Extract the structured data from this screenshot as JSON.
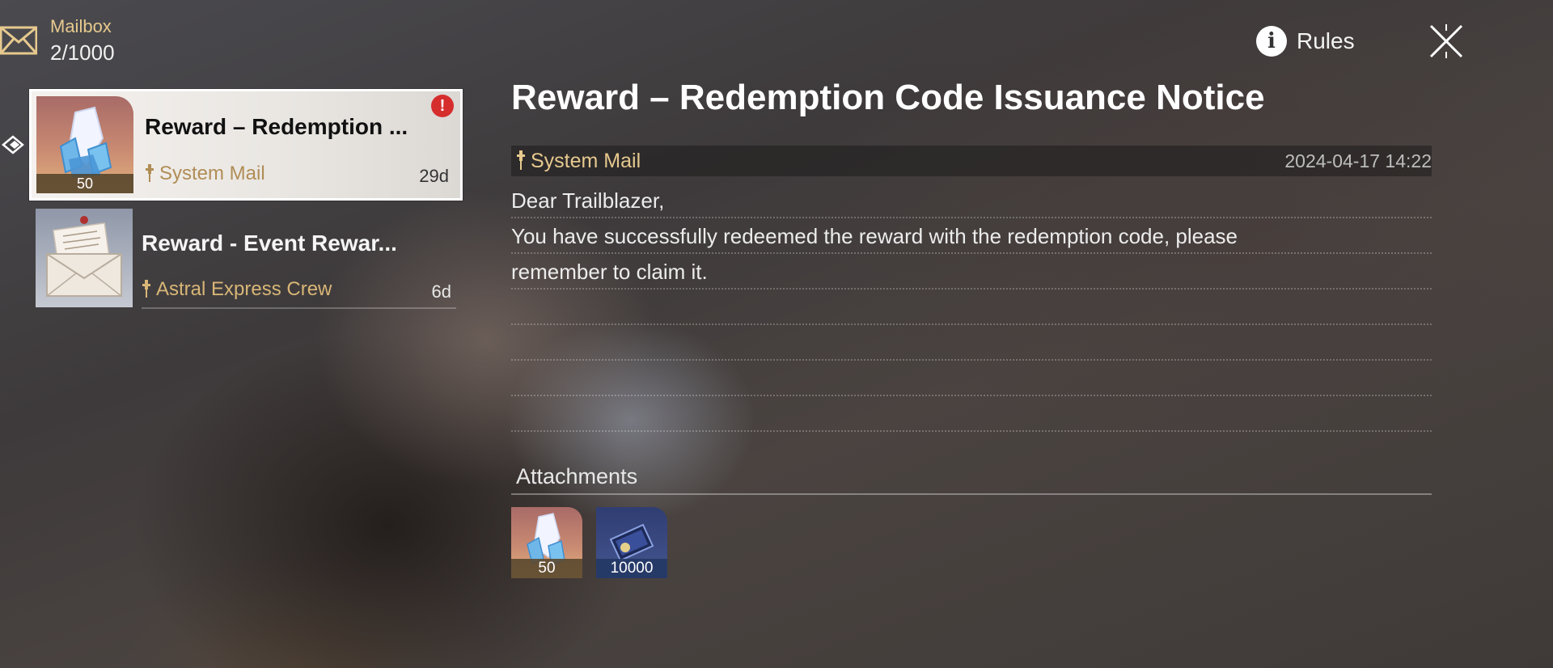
{
  "header": {
    "mailbox_label": "Mailbox",
    "mailbox_count": "2/1000",
    "rules_label": "Rules",
    "icons": {
      "mail": "envelope-icon",
      "rules": "info-icon",
      "close": "close-icon"
    }
  },
  "mail_list": [
    {
      "title": "Reward – Redemption ...",
      "sender": "System Mail",
      "age": "29d",
      "thumb_qty": "50",
      "thumb": "stellar-jade-crystal",
      "unread_badge": "!",
      "selected": true
    },
    {
      "title": "Reward - Event Rewar...",
      "sender": "Astral Express Crew",
      "age": "6d",
      "thumb": "envelope-letter",
      "selected": false
    }
  ],
  "detail": {
    "title": "Reward – Redemption Code Issuance Notice",
    "sender": "System Mail",
    "date": "2024-04-17 14:22",
    "body_lines": [
      "Dear Trailblazer,",
      "You have successfully redeemed the reward with the redemption code, please",
      "remember to claim it.",
      "",
      "",
      "",
      ""
    ],
    "attachments_label": "Attachments",
    "attachments": [
      {
        "item": "stellar-jade-crystal",
        "qty": "50"
      },
      {
        "item": "credit-card-ticket",
        "qty": "10000"
      }
    ]
  },
  "colors": {
    "gold_text": "#e6c98e",
    "badge_red": "#d62d2d",
    "selected_bg": "#f4f1ee"
  }
}
